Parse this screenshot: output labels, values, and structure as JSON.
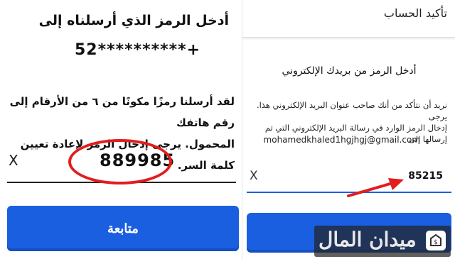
{
  "left": {
    "title": "أدخل الرمز الذي أرسلناه إلى",
    "phone": "52**********+",
    "message_line1": "لقد أرسلنا رمزًا مكونًا من ٦ من الأرقام إلى رقم هاتفك",
    "message_line2": "المحمول. يرجى إدخال الرمز لإعادة تعيين كلمة السر.",
    "clear_label": "X",
    "code_value": "889985",
    "continue_label": "متابعة"
  },
  "right": {
    "header_title": "تأكيد الحساب",
    "title": "أدخل الرمز من بريدك الإلكتروني",
    "message_line1": "نريد أن نتأكد من أنك صاحب عنوان البريد الإلكتروني هذا. يرجى",
    "message_line2": "إدخال الرمز الوارد في رسالة البريد الإلكتروني التي تم إرسالها إلى",
    "email": "mohamedkhaled1hgjhgj@gmail.com",
    "clear_label": "X",
    "code_value": "85215"
  },
  "watermark": {
    "text": "ميدان المال"
  },
  "colors": {
    "button_blue": "#1a5fe0",
    "highlight_red": "#e21d1d"
  }
}
